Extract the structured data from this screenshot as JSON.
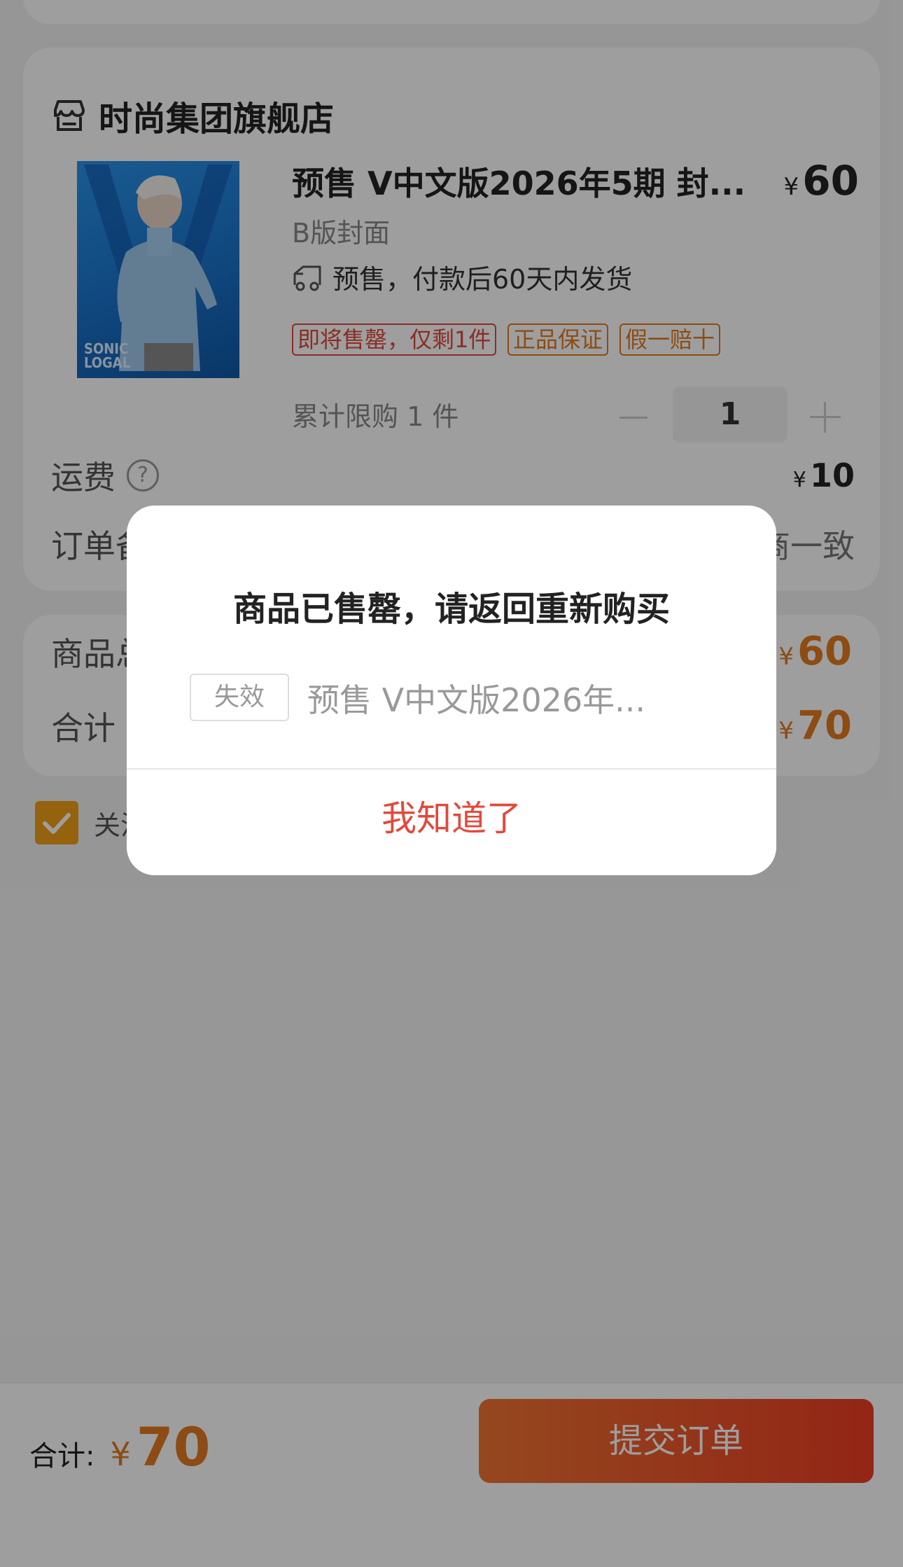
{
  "shop": {
    "name": "时尚集团旗舰店",
    "icon": "shop-icon"
  },
  "product": {
    "title": "预售 V中文版2026年5期 封...",
    "price_symbol": "¥",
    "price": "60",
    "variant": "B版封面",
    "shipping_note": "预售，付款后60天内发货",
    "shipping_icon": "truck-icon",
    "tags": [
      {
        "label": "即将售罄，仅剩1件",
        "color": "#e14a3c"
      },
      {
        "label": "正品保证",
        "color": "#e27b1f"
      },
      {
        "label": "假一赔十",
        "color": "#e27b1f"
      }
    ],
    "limit_text": "累计限购 1 件",
    "quantity": "1",
    "cover": {
      "letter": "V",
      "text_line1": "SONIC",
      "text_line2": "LOGAL"
    }
  },
  "order": {
    "freight_label": "运费",
    "freight_symbol": "¥",
    "freight_value": "10",
    "remark_label_partial": "订单备",
    "remark_value_partial": "商一致"
  },
  "summary": {
    "subtotal_label_partial": "商品总",
    "subtotal_symbol": "¥",
    "subtotal_value": "60",
    "total_label_partial": "合计",
    "total_symbol": "¥",
    "total_value": "70"
  },
  "agreement": {
    "text_partial": "关注"
  },
  "bottom_bar": {
    "total_label": "合计:",
    "total_symbol": "¥",
    "total_value": "70",
    "submit_label": "提交订单"
  },
  "dialog": {
    "title": "商品已售罄，请返回重新购买",
    "invalid_badge": "失效",
    "item_name": "预售 V中文版2026年...",
    "confirm_label": "我知道了"
  },
  "colors": {
    "accent_orange": "#e27b1f",
    "danger_red": "#e14a3c",
    "submit_gradient_start": "#f07432",
    "submit_gradient_end": "#ee3d24"
  }
}
